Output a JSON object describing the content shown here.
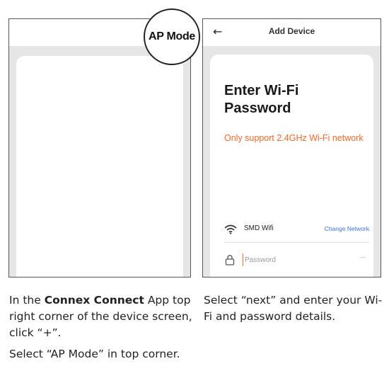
{
  "left_screen": {
    "callout": "AP Mode"
  },
  "right_screen": {
    "header_title": "Add Device",
    "back_icon": "arrow-left-icon",
    "heading": "Enter Wi-Fi Password",
    "warning": "Only support 2.4GHz Wi-Fi network",
    "wifi": {
      "icon": "wifi-icon",
      "network_name": "SMD Wifi",
      "change_link": "Change Network"
    },
    "password": {
      "icon": "lock-icon",
      "placeholder": "Password",
      "value": ""
    },
    "colors": {
      "warning": "#f26a2b",
      "link": "#3a6fd8"
    }
  },
  "captions": {
    "left_1_prefix": "In the ",
    "left_1_bold": "Connex Connect",
    "left_1_suffix": " App top right corner of the device screen, click “+”.",
    "left_2": "Select “AP Mode” in top corner.",
    "right": "Select “next” and enter your Wi-Fi and password details."
  }
}
